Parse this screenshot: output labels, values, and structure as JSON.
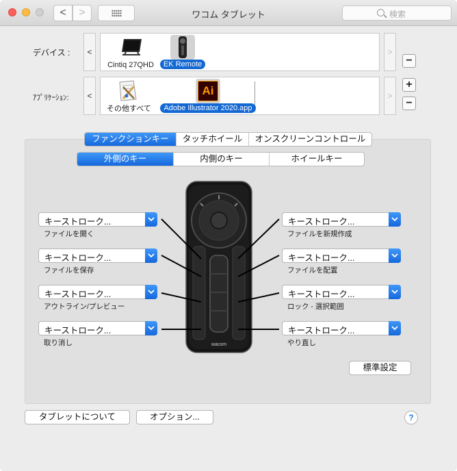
{
  "window": {
    "title": "ワコム タブレット"
  },
  "toolbar": {
    "back": "<",
    "forward": ">",
    "search_placeholder": "検索"
  },
  "devices": {
    "label": "デバイス :",
    "scroll_left": "<",
    "scroll_right": ">",
    "remove": "−",
    "items": [
      {
        "label": "Cintiq 27QHD",
        "icon": "tablet-display-icon",
        "selected": false
      },
      {
        "label": "EK Remote",
        "icon": "express-key-remote-icon",
        "selected": true
      }
    ]
  },
  "applications": {
    "label": "ｱﾌﾟﾘｹｰｼｮﾝ:",
    "scroll_left": "<",
    "scroll_right": ">",
    "add": "+",
    "remove": "−",
    "items": [
      {
        "label": "その他すべて",
        "icon": "all-apps-icon",
        "selected": false
      },
      {
        "label": "Adobe Illustrator 2020.app",
        "icon": "illustrator-icon",
        "icon_text": "Ai",
        "selected": true
      }
    ]
  },
  "main_tabs": [
    "ファンクションキー",
    "タッチホイール",
    "オンスクリーンコントロール"
  ],
  "sub_tabs": [
    "外側のキー",
    "内側のキー",
    "ホイールキー"
  ],
  "keys_left": [
    {
      "value": "キーストローク...",
      "label": "ファイルを開く"
    },
    {
      "value": "キーストローク...",
      "label": "ファイルを保存"
    },
    {
      "value": "キーストローク...",
      "label": "アウトライン/プレビュー"
    },
    {
      "value": "キーストローク...",
      "label": "取り消し"
    }
  ],
  "keys_right": [
    {
      "value": "キーストローク...",
      "label": "ファイルを新規作成"
    },
    {
      "value": "キーストローク...",
      "label": "ファイルを配置"
    },
    {
      "value": "キーストローク...",
      "label": "ロック - 選択範囲"
    },
    {
      "value": "キーストローク...",
      "label": "やり直し"
    }
  ],
  "device_brand": "wacom",
  "defaults_button": "標準設定",
  "bottom": {
    "about": "タブレットについて",
    "options": "オプション...",
    "help": "?"
  },
  "colors": {
    "accent": "#1568dc",
    "close": "#fc605c",
    "minimize": "#fdbc40",
    "illustrator_bg": "#330000",
    "illustrator_fg": "#ff9a00"
  }
}
